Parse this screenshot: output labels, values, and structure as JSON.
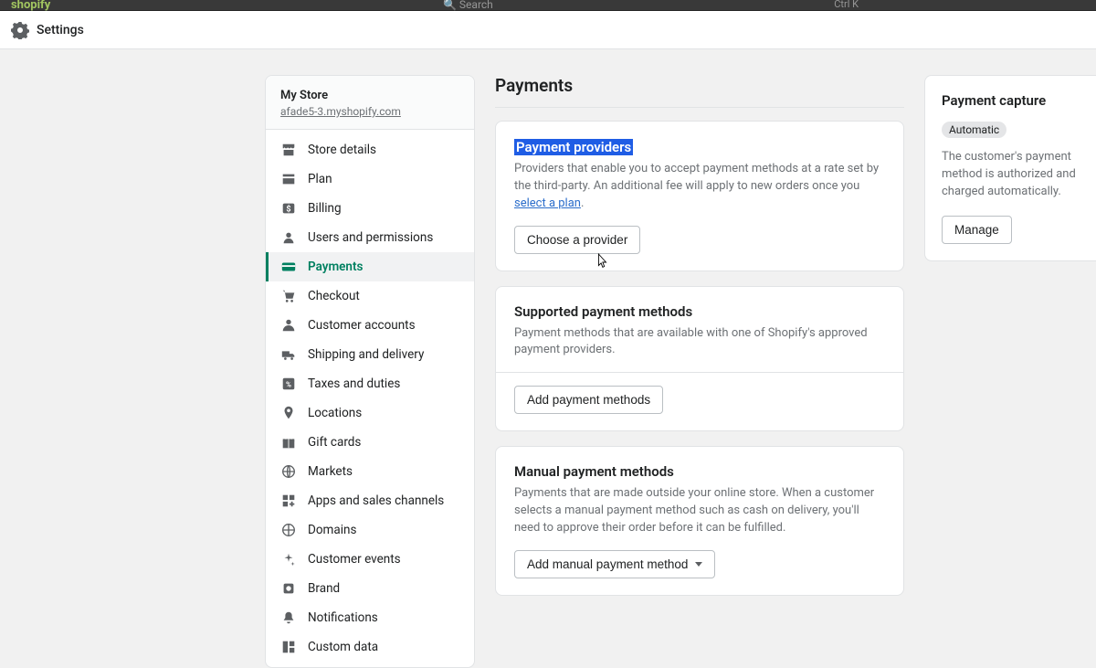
{
  "topbar": {
    "brand": "shopify",
    "search": "Search",
    "shortcut": "Ctrl K"
  },
  "settings_bar": {
    "label": "Settings"
  },
  "store": {
    "name": "My Store",
    "url": "afade5-3.myshopify.com"
  },
  "nav": [
    {
      "label": "Store details"
    },
    {
      "label": "Plan"
    },
    {
      "label": "Billing"
    },
    {
      "label": "Users and permissions"
    },
    {
      "label": "Payments"
    },
    {
      "label": "Checkout"
    },
    {
      "label": "Customer accounts"
    },
    {
      "label": "Shipping and delivery"
    },
    {
      "label": "Taxes and duties"
    },
    {
      "label": "Locations"
    },
    {
      "label": "Gift cards"
    },
    {
      "label": "Markets"
    },
    {
      "label": "Apps and sales channels"
    },
    {
      "label": "Domains"
    },
    {
      "label": "Customer events"
    },
    {
      "label": "Brand"
    },
    {
      "label": "Notifications"
    },
    {
      "label": "Custom data"
    }
  ],
  "page": {
    "title": "Payments"
  },
  "cards": {
    "providers": {
      "title": "Payment providers",
      "desc_pre": "Providers that enable you to accept payment methods at a rate set by the third-party. An additional fee will apply to new orders once you ",
      "link": "select a plan",
      "desc_post": ".",
      "button": "Choose a provider"
    },
    "supported": {
      "title": "Supported payment methods",
      "desc": "Payment methods that are available with one of Shopify's approved payment providers.",
      "button": "Add payment methods"
    },
    "manual": {
      "title": "Manual payment methods",
      "desc": "Payments that are made outside your online store. When a customer selects a manual payment method such as cash on delivery, you'll need to approve their order before it can be fulfilled.",
      "button": "Add manual payment method"
    }
  },
  "capture": {
    "title": "Payment capture",
    "badge": "Automatic",
    "desc": "The customer's payment method is authorized and charged automatically.",
    "button": "Manage"
  }
}
